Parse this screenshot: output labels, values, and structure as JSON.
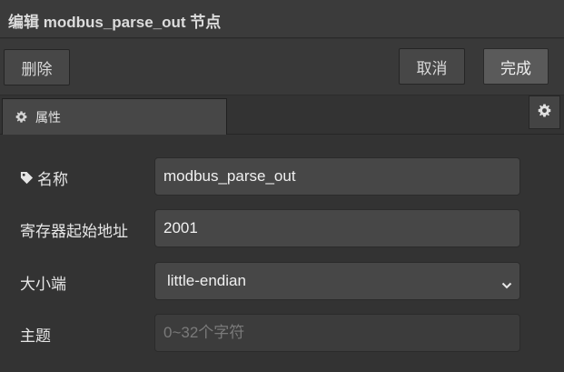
{
  "dialog": {
    "title": "编辑 modbus_parse_out 节点"
  },
  "toolbar": {
    "delete_label": "删除",
    "cancel_label": "取消",
    "done_label": "完成"
  },
  "tabs": {
    "properties_label": "属性",
    "properties_icon": "gear-icon",
    "settings_icon": "gear-icon"
  },
  "form": {
    "name": {
      "label": "名称",
      "icon": "tag-icon",
      "value": "modbus_parse_out"
    },
    "register_start": {
      "label": "寄存器起始地址",
      "value": "2001"
    },
    "endianness": {
      "label": "大小端",
      "selected": "little-endian"
    },
    "topic": {
      "label": "主题",
      "value": "",
      "placeholder": "0~32个字符"
    }
  },
  "colors": {
    "background": "#333333",
    "field_background": "#474747",
    "text": "#e6e6e6"
  }
}
